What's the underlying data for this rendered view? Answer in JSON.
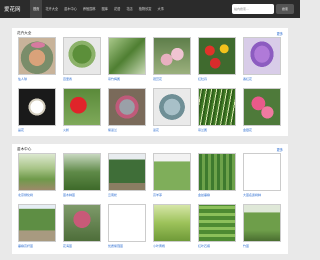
{
  "header": {
    "logo": "爱花网",
    "nav": [
      "首页",
      "花卉大全",
      "苗木中心",
      "养殖园林",
      "图库",
      "花语",
      "花店",
      "植物欣赏",
      "大事"
    ],
    "search_placeholder": "站内搜索...",
    "search_button": "搜索"
  },
  "section1": {
    "title": "花卉大全",
    "more": "更多",
    "items": [
      {
        "label": "仙人球",
        "icon": "cactus-image"
      },
      {
        "label": "百里香",
        "icon": "thyme-image"
      },
      {
        "label": "吊竹梅属",
        "icon": "fern-image"
      },
      {
        "label": "观赏花",
        "icon": "pink-flower-image"
      },
      {
        "label": "红牡丹",
        "icon": "red-yellow-flowers-image"
      },
      {
        "label": "番红花",
        "icon": "crocus-image"
      },
      {
        "label": "昙花",
        "icon": "night-cactus-flower-image"
      },
      {
        "label": "火鹤",
        "icon": "anthurium-image"
      },
      {
        "label": "紫蓝兰",
        "icon": "succulent-image"
      },
      {
        "label": "蓝花",
        "icon": "blue-succulent-image"
      },
      {
        "label": "吊兰属",
        "icon": "spider-plant-image"
      },
      {
        "label": "金银花",
        "icon": "pink-lily-image"
      }
    ]
  },
  "section2": {
    "title": "苗木中心",
    "more": "更多",
    "items": [
      {
        "label": "北京绿化树",
        "icon": "tree-nursery-image"
      },
      {
        "label": "苗木种苗",
        "icon": "seedling-image"
      },
      {
        "label": "云南松",
        "icon": "pine-image"
      },
      {
        "label": "高羊茅",
        "icon": "grass-image"
      },
      {
        "label": "金丝垂柳",
        "icon": "willow-image"
      },
      {
        "label": "大苗名贵树种",
        "icon": "blank-image"
      },
      {
        "label": "垂柳高杆苗",
        "icon": "tall-tree-image"
      },
      {
        "label": "花海苗",
        "icon": "pink-shrub-image"
      },
      {
        "label": "优质紫薇苗",
        "icon": "blank-image"
      },
      {
        "label": "小叶黄杨",
        "icon": "boxwood-image"
      },
      {
        "label": "红叶石楠",
        "icon": "shrub-rows-image"
      },
      {
        "label": "竹苗",
        "icon": "bamboo-image"
      }
    ]
  },
  "colors": {
    "topbar": "#2b2b2b",
    "link": "#2a6bd0"
  }
}
